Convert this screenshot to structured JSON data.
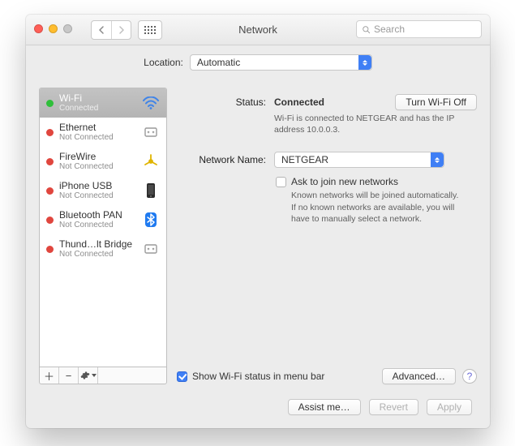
{
  "window": {
    "title": "Network"
  },
  "search": {
    "placeholder": "Search"
  },
  "location": {
    "label": "Location:",
    "value": "Automatic"
  },
  "sidebar": {
    "items": [
      {
        "name": "Wi-Fi",
        "status": "Connected",
        "dot": "green",
        "icon": "wifi",
        "selected": true
      },
      {
        "name": "Ethernet",
        "status": "Not Connected",
        "dot": "red",
        "icon": "ethernet"
      },
      {
        "name": "FireWire",
        "status": "Not Connected",
        "dot": "red",
        "icon": "firewire"
      },
      {
        "name": "iPhone USB",
        "status": "Not Connected",
        "dot": "red",
        "icon": "iphone"
      },
      {
        "name": "Bluetooth PAN",
        "status": "Not Connected",
        "dot": "red",
        "icon": "bluetooth"
      },
      {
        "name": "Thund…lt Bridge",
        "status": "Not Connected",
        "dot": "red",
        "icon": "thunderbolt"
      }
    ]
  },
  "pane": {
    "status_label": "Status:",
    "status_value": "Connected",
    "turn_off": "Turn Wi-Fi Off",
    "status_desc": "Wi-Fi is connected to NETGEAR and has the IP address 10.0.0.3.",
    "netname_label": "Network Name:",
    "netname_value": "NETGEAR",
    "ask_label": "Ask to join new networks",
    "ask_checked": false,
    "ask_desc": "Known networks will be joined automatically. If no known networks are available, you will have to manually select a network.",
    "show_status_label": "Show Wi-Fi status in menu bar",
    "show_status_checked": true,
    "advanced": "Advanced…"
  },
  "footer": {
    "assist": "Assist me…",
    "revert": "Revert",
    "apply": "Apply"
  }
}
